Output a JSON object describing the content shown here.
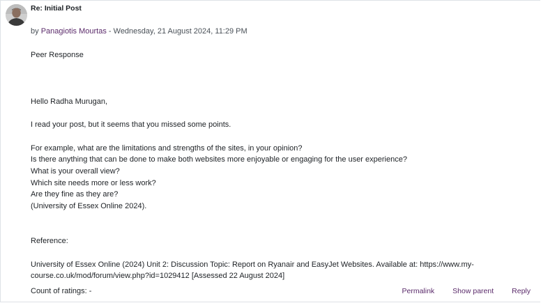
{
  "post": {
    "title": "Re: Initial Post",
    "by_prefix": "by ",
    "author": "Panagiotis Mourtas",
    "date": " - Wednesday, 21 August 2024, 11:29 PM",
    "body": {
      "heading": "Peer Response",
      "greeting": "Hello Radha Murugan,",
      "intro": "I read your post, but it seems that you missed some points.",
      "questions": [
        "For example, what are the limitations and strengths of the sites, in your opinion?",
        "Is there anything that can be done to make both websites more enjoyable or engaging for the user experience?",
        "What is your overall view?",
        "Which site needs more or less work?",
        "Are they fine as they are?",
        "(University of Essex Online 2024)."
      ],
      "reference_label": "Reference:",
      "reference_text": "University of Essex Online (2024) Unit 2: Discussion Topic: Report on Ryanair and EasyJet Websites. Available at: https://www.my-course.co.uk/mod/forum/view.php?id=1029412 [Assessed 22 August 2024]"
    },
    "ratings": "Count of ratings: -",
    "actions": {
      "permalink": "Permalink",
      "show_parent": "Show parent",
      "reply": "Reply"
    },
    "avatar_icon": "user-avatar-icon"
  },
  "colors": {
    "link": "#5a2a6a",
    "text": "#1d2125",
    "border": "#dee2e6"
  }
}
